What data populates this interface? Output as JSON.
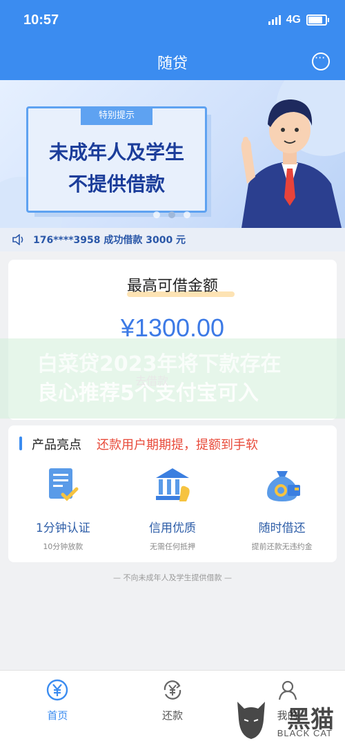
{
  "status_bar": {
    "time": "10:57",
    "network": "4G"
  },
  "navbar": {
    "title": "随贷"
  },
  "banner": {
    "tag": "特别提示",
    "line1": "未成年人及学生",
    "line2": "不提供借款",
    "dot_count": 3
  },
  "notice": {
    "text": "176****3958 成功借款 3000 元"
  },
  "loan_card": {
    "label": "最高可借金额",
    "amount": "¥1300.00"
  },
  "overlay": {
    "line1": "白菜贷2023年将下款存在",
    "line2": "良心推荐5个支付宝可入",
    "button_text": "去借款"
  },
  "product": {
    "title": "产品亮点",
    "slogan": "还款用户期期提，提额到手软",
    "features": [
      {
        "name": "1分钟认证",
        "desc": "10分钟放款",
        "icon": "document-check-icon"
      },
      {
        "name": "信用优质",
        "desc": "无需任何抵押",
        "icon": "bank-icon"
      },
      {
        "name": "随时借还",
        "desc": "提前还款无违约金",
        "icon": "money-bag-icon"
      }
    ]
  },
  "disclaimer": "— 不向未成年人及学生提供借款 —",
  "tabbar": {
    "tabs": [
      {
        "label": "首页",
        "icon": "yuan-circle-icon",
        "active": true
      },
      {
        "label": "还款",
        "icon": "yuan-refresh-icon",
        "active": false
      },
      {
        "label": "我的",
        "icon": "user-icon",
        "active": false
      }
    ]
  },
  "watermark": {
    "cn": "黑猫",
    "en": "BLACK CAT"
  },
  "colors": {
    "primary": "#3b8cf0",
    "accent_red": "#e84a3a",
    "amount_blue": "#3c7ae6"
  }
}
